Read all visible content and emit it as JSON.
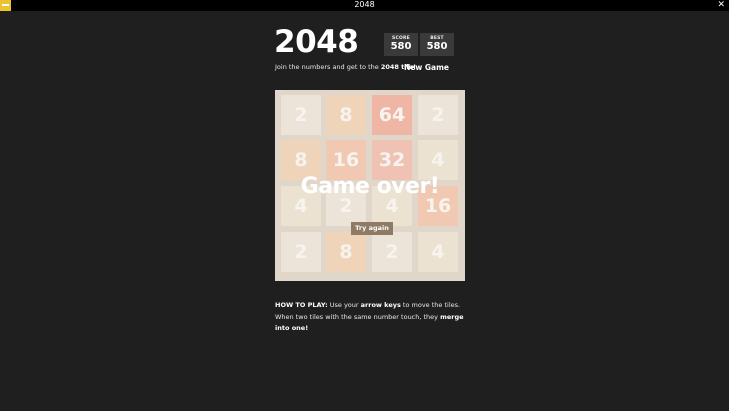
{
  "window": {
    "title": "2048",
    "close_label": "✕"
  },
  "header": {
    "game_title": "2048",
    "score_label": "SCORE",
    "score_value": "580",
    "best_label": "BEST",
    "best_value": "580"
  },
  "intro": {
    "text": "Join the numbers and get to the ",
    "highlight": "2048 tile!",
    "new_game_label": "New Game"
  },
  "board": {
    "tiles": [
      [
        "2",
        "8",
        "64",
        "2"
      ],
      [
        "8",
        "16",
        "32",
        "4"
      ],
      [
        "4",
        "2",
        "4",
        "16"
      ],
      [
        "2",
        "8",
        "2",
        "4"
      ]
    ]
  },
  "overlay": {
    "message": "Game over!",
    "try_again_label": "Try again"
  },
  "howto": {
    "label": "HOW TO PLAY:",
    "part1": " Use your ",
    "keys": "arrow keys",
    "part2": " to move the tiles. When two tiles with the same number touch, they ",
    "merge": "merge into one!"
  },
  "colors": {
    "background": "#1f1f1f",
    "board": "#d6cabd",
    "button": "#8f7a66",
    "tile_2": "#ece3d8",
    "tile_4": "#ebe0cc",
    "tile_8": "#f1c7a0",
    "tile_16": "#f4b393",
    "tile_32": "#f3a694",
    "tile_64": "#f2907b"
  }
}
